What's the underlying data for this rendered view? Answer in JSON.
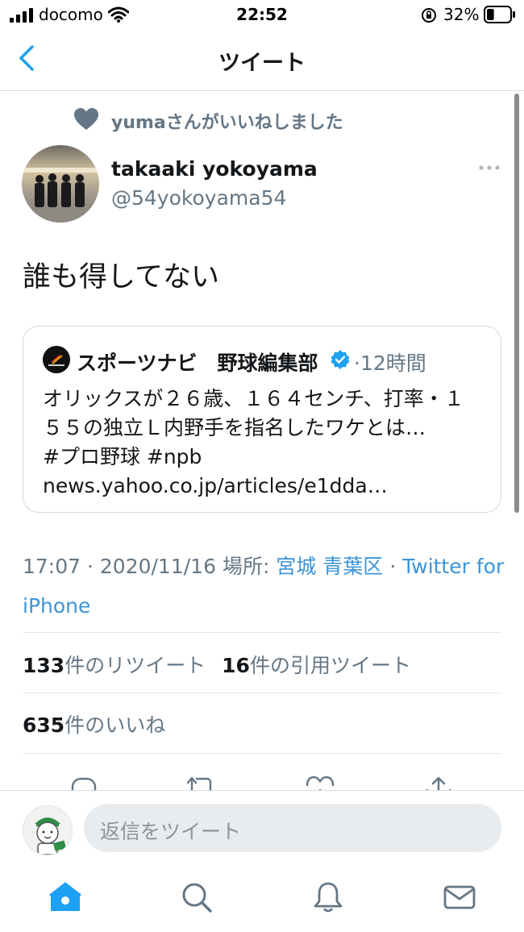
{
  "status_bar": {
    "carrier": "docomo",
    "time": "22:52",
    "battery": "32%",
    "battery_level": 0.32
  },
  "nav": {
    "title": "ツイート"
  },
  "tweet": {
    "liked_by": "yumaさんがいいねしました",
    "author_name": "takaaki yokoyama",
    "author_handle": "@54yokoyama54",
    "text": "誰も得してない",
    "quote": {
      "name": "スポーツナビ　野球編集部",
      "time": "·12時間",
      "text_lines": [
        "オリックスが２６歳、１６４センチ、打率・１",
        "５５の独立Ｌ内野手を指名したワケとは…",
        "#プロ野球 #npb",
        "news.yahoo.co.jp/articles/e1dda…"
      ]
    },
    "meta": {
      "timestamp": "17:07 · 2020/11/16 ",
      "location_label": "場所: ",
      "location": "宮城 青葉区",
      "separator": " · ",
      "source": "Twitter for iPhone"
    },
    "stats": {
      "retweets_count": "133",
      "retweets_label": "件のリツイート",
      "quotes_count": "16",
      "quotes_label": "件の引用ツイート",
      "likes_count": "635",
      "likes_label": "件のいいね"
    }
  },
  "reply": {
    "placeholder": "返信をツイート"
  },
  "tabbar": {
    "items": [
      "home-icon",
      "search-icon",
      "notifications-icon",
      "messages-icon"
    ],
    "active": "home-icon"
  },
  "colors": {
    "accent": "#1da1f2",
    "text": "#14171a",
    "secondary": "#657786"
  }
}
